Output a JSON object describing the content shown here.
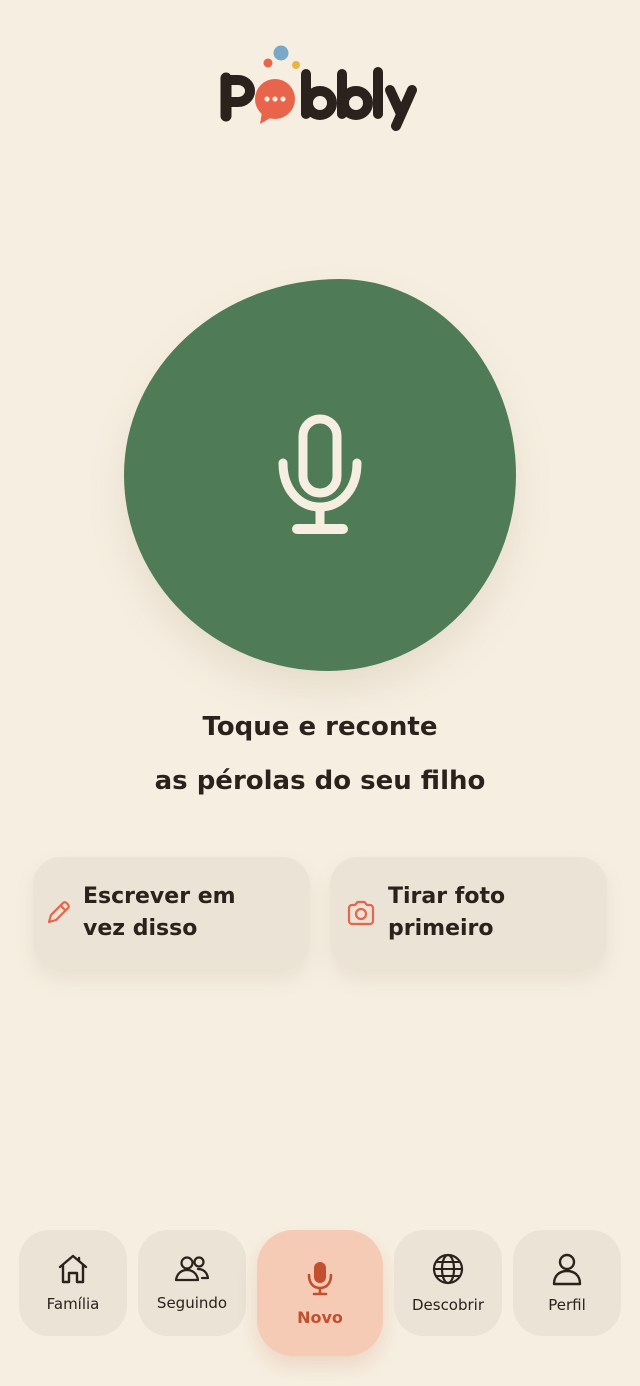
{
  "app": {
    "logo_text": "Pobbly"
  },
  "main": {
    "prompt_line1": "Toque e reconte",
    "prompt_line2": "as pérolas do seu filho"
  },
  "actions": {
    "write_label": "Escrever em vez disso",
    "photo_label": "Tirar foto primeiro"
  },
  "nav": {
    "items": [
      {
        "label": "Família",
        "icon": "home-icon"
      },
      {
        "label": "Seguindo",
        "icon": "users-icon"
      },
      {
        "label": "Novo",
        "icon": "mic-icon",
        "active": true
      },
      {
        "label": "Descobrir",
        "icon": "globe-icon"
      },
      {
        "label": "Perfil",
        "icon": "user-icon"
      }
    ]
  },
  "colors": {
    "background": "#f6efe1",
    "primary_green": "#4f7b56",
    "accent_coral": "#e8644a",
    "active_nav_bg": "#f6cbb6",
    "card_bg": "#ebe3d5",
    "text_dark": "#2b211d"
  }
}
